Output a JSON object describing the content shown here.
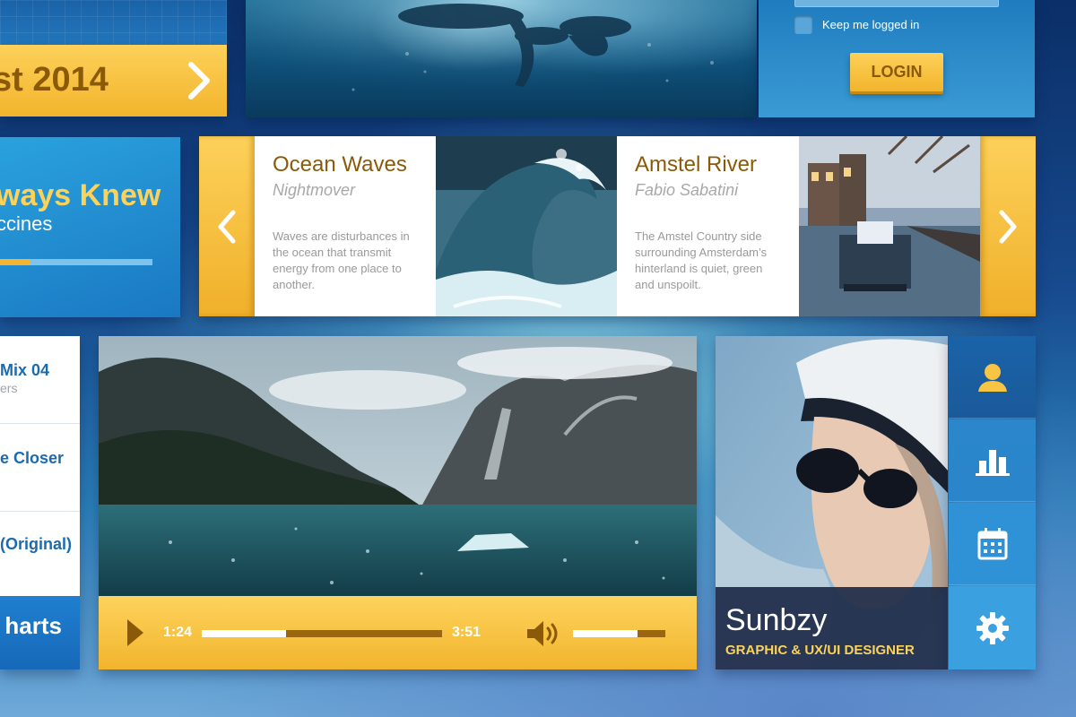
{
  "colors": {
    "accent_yellow": "#f8c444",
    "brand_blue": "#1f7cbf",
    "dark_gold": "#8a5a08",
    "navy": "#1c2a48"
  },
  "promo_banner": {
    "text": "st 2014",
    "icon": "chevron-right-icon"
  },
  "login": {
    "keep_logged_in_label": "Keep me logged in",
    "button_label": "LOGIN"
  },
  "promo_card": {
    "title": "ways Knew",
    "subtitle": "ccines",
    "progress": 0.2
  },
  "carousel": {
    "prev_icon": "chevron-left-icon",
    "next_icon": "chevron-right-icon",
    "slides": [
      {
        "title": "Ocean Waves",
        "author": "Nightmover",
        "description": "Waves are disturbances in the ocean that transmit energy from one place to another."
      },
      {
        "title": "Amstel River",
        "author": "Fabio Sabatini",
        "description": "The Amstel Country side surrounding Amsterdam’s hinterland is quiet, green and unspoilt."
      }
    ]
  },
  "playlist": {
    "items": [
      {
        "title": "Mix 04",
        "subtitle": "ers"
      },
      {
        "title": "e Closer"
      },
      {
        "title": "(Original)"
      }
    ],
    "footer_label": "harts"
  },
  "video": {
    "current_time": "1:24",
    "duration": "3:51",
    "progress": 0.35,
    "volume": 0.7,
    "play_icon": "play-icon",
    "volume_icon": "speaker-icon"
  },
  "profile": {
    "name": "Sunbzy",
    "role": "GRAPHIC & UX/UI DESIGNER",
    "menu": [
      {
        "icon": "user-icon",
        "active": true
      },
      {
        "icon": "bar-chart-icon",
        "active": false
      },
      {
        "icon": "calendar-icon",
        "active": false
      },
      {
        "icon": "gear-icon",
        "active": false
      }
    ]
  }
}
